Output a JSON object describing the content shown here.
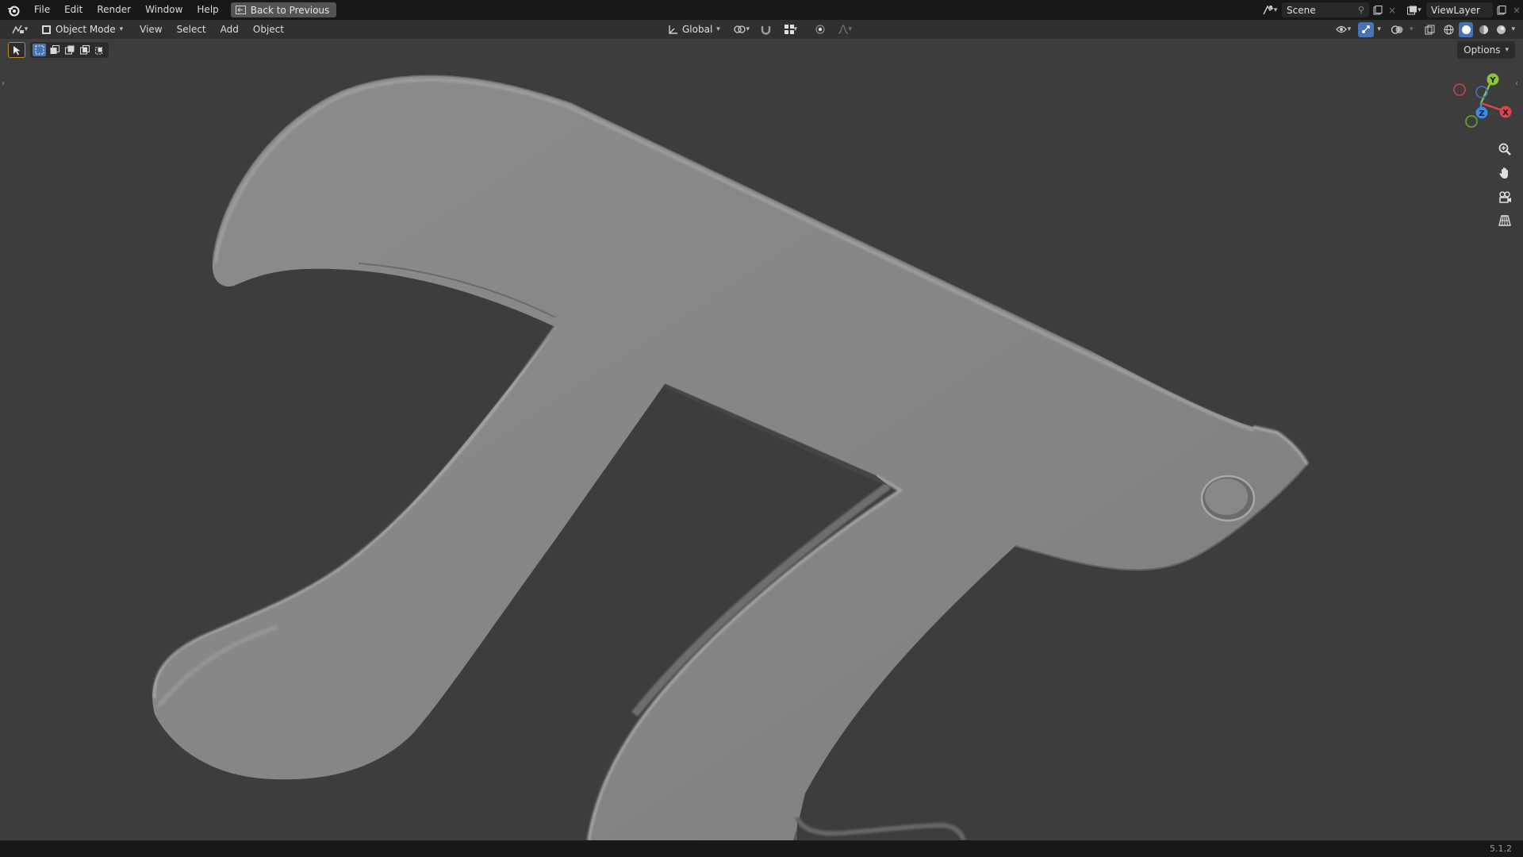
{
  "topbar": {
    "menus": [
      "File",
      "Edit",
      "Render",
      "Window",
      "Help"
    ],
    "back_button": "Back to Previous",
    "scene": "Scene",
    "view_layer": "ViewLayer"
  },
  "header": {
    "mode": "Object Mode",
    "menus": [
      "View",
      "Select",
      "Add",
      "Object"
    ],
    "transform_orientation": "Global",
    "options": "Options"
  },
  "status": {
    "version": "5.1.2"
  },
  "gizmo": {
    "x": "X",
    "y": "Y",
    "z": "Z"
  },
  "colors": {
    "topbar": "#181818",
    "header": "#303030",
    "viewport": "#3d3d3d",
    "accent": "#4772b3",
    "axis_x": "#e0434f",
    "axis_y": "#8bc43a",
    "axis_z": "#3f89e6"
  }
}
